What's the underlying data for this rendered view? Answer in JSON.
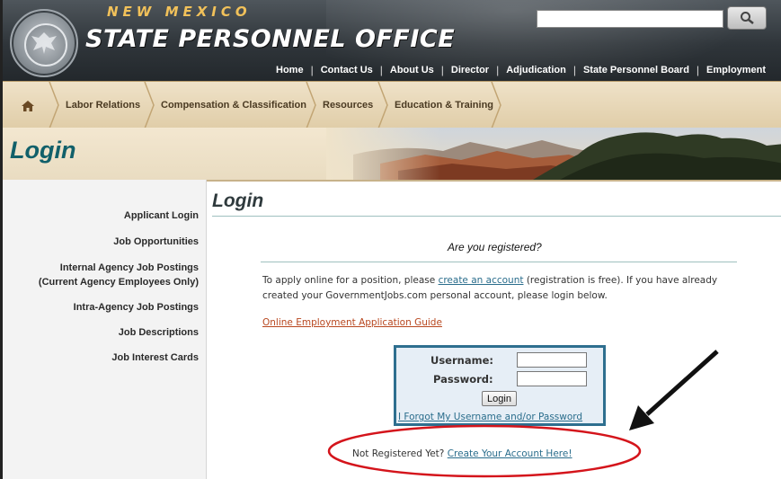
{
  "header": {
    "brand_top": "NEW MEXICO",
    "brand_main": "STATE PERSONNEL OFFICE",
    "seal_icon": "state-seal-icon",
    "search": {
      "value": "",
      "button_icon": "search-icon"
    },
    "top_nav": [
      "Home",
      "Contact Us",
      "About Us",
      "Director",
      "Adjudication",
      "State Personnel Board",
      "Employment"
    ]
  },
  "breadcrumb_nav": {
    "home_icon": "home-icon",
    "items": [
      "Labor Relations",
      "Compensation & Classification",
      "Resources",
      "Education & Training"
    ]
  },
  "banner": {
    "title": "Login"
  },
  "sidebar": {
    "items": [
      "Applicant Login",
      "Job Opportunities",
      "Internal Agency Job Postings",
      "(Current Agency Employees Only)",
      "Intra-Agency Job Postings",
      "Job Descriptions",
      "Job Interest Cards"
    ]
  },
  "main": {
    "title": "Login",
    "question": "Are you registered?",
    "info_pre": "To apply online for a position, please ",
    "info_link": "create an account",
    "info_post": " (registration is free). If you have already created your GovernmentJobs.com personal account, please login below.",
    "guide_link": "Online Employment Application Guide",
    "login": {
      "username_label": "Username:",
      "username_value": "",
      "password_label": "Password:",
      "password_value": "",
      "button": "Login",
      "forgot": "I Forgot My Username and/or Password"
    },
    "not_registered": "Not Registered Yet?",
    "create_link": "Create Your Account Here!"
  },
  "colors": {
    "header_dark": "#2f353a",
    "brand_gold": "#f1c15a",
    "teal_title": "#11606a",
    "link": "#2a6d8c",
    "guide_link": "#b8471f",
    "annotation_red": "#d4141b"
  }
}
